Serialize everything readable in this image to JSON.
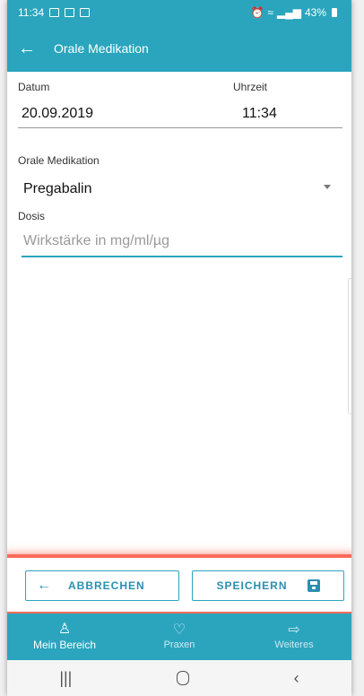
{
  "status": {
    "time": "11:34",
    "battery": "43%"
  },
  "header": {
    "title": "Orale Medikation"
  },
  "form": {
    "date_label": "Datum",
    "date_value": "20.09.2019",
    "time_label": "Uhrzeit",
    "time_value": "11:34",
    "medication_label": "Orale Medikation",
    "medication_value": "Pregabalin",
    "dose_label": "Dosis",
    "dose_placeholder": "Wirkstärke in mg/ml/µg"
  },
  "actions": {
    "cancel_label": "ABBRECHEN",
    "save_label": "SPEICHERN"
  },
  "bottom_nav": [
    {
      "label": "Mein Bereich",
      "icon": "person-icon"
    },
    {
      "label": "Praxen",
      "icon": "heart-icon"
    },
    {
      "label": "Weiteres",
      "icon": "arrow-right-icon"
    }
  ],
  "colors": {
    "primary": "#2aa5bd",
    "highlight": "#ff6b5a",
    "accent_text": "#2a8fb0"
  }
}
